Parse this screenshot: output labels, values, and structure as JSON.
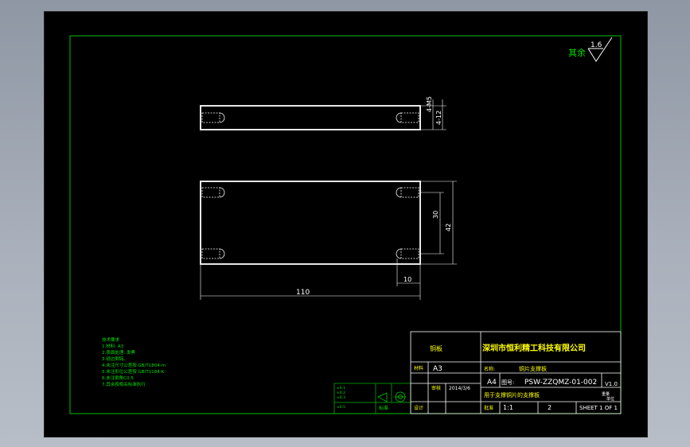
{
  "drawing": {
    "roughness_label": "其余",
    "roughness_value": "1.6",
    "dims": {
      "hole_note": "4-M5",
      "depth": "4-12",
      "height_inner": "30",
      "height_outer": "42",
      "length": "110",
      "offset": "10"
    },
    "tech_requirements": [
      "技术要求",
      "1.材料: A3",
      "2.表面处理: 发黑",
      "3.锐边倒钝。",
      "4.未注尺寸公差按 GB/T1804-m",
      "5.未注形位公差按 GB/T1184-K",
      "6.未注倒角C0.5",
      "7.其余按相关标准执行"
    ]
  },
  "title_block": {
    "company": "深圳市恒利精工科技有限公司",
    "material_label": "材料",
    "material_value": "A3",
    "drawing_no_label": "图号:",
    "drawing_no": "PSW-ZZQMZ-01-002",
    "version": "V1.0",
    "name_label": "名称:",
    "part_name": "铜片支撑板",
    "sheet_size": "A4",
    "scale": "1:1",
    "quantity": "2",
    "sheet": "SHEET 1 OF 1",
    "date": "2014/3/6",
    "checked": "审核",
    "designed": "设计",
    "approved": "批准",
    "description": "用于支撑铜片的支撑板",
    "weight_label": "重量",
    "weight": "0.1",
    "unit_label": "单位"
  },
  "colors": {
    "frame": "#00c000",
    "part": "#ffffff",
    "dim": "#ffffff",
    "title": "#ffff00"
  }
}
